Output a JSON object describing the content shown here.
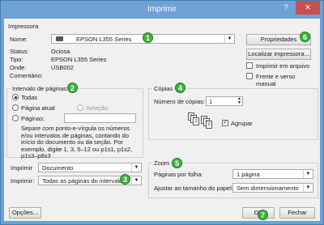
{
  "window": {
    "title": "Imprimir",
    "help": "?",
    "close": "✕"
  },
  "printer": {
    "group_title": "Impressora",
    "name_label": "Nome:",
    "name_value": "EPSON L355 Series",
    "status_label": "Status:",
    "status_value": "Ociosa",
    "type_label": "Tipo:",
    "type_value": "EPSON L355 Series",
    "where_label": "Onde:",
    "where_value": "USB002",
    "comment_label": "Comentário:",
    "properties_button": "Propriedades",
    "find_button": "Localizar impressora...",
    "print_to_file": "Imprimir em arquivo",
    "duplex_manual": "Frente e verso manual"
  },
  "range": {
    "group_title": "Intervalo de páginas",
    "all": "Todas",
    "current": "Página atual",
    "selection": "Seleção",
    "pages": "Páginas:",
    "pages_value": "",
    "hint": "Separe com ponto-e-vírgula os números e/ou intervalos de páginas, contando do início do documento ou da seção. Por exemplo, digite 1, 3, 5–12 ou p1s1, p1s2, p1s3–p8s3"
  },
  "copies": {
    "group_title": "Cópias",
    "count_label": "Número de cópias:",
    "count_value": "1",
    "collate": "Agrupar"
  },
  "print_what": {
    "label": "Imprimir",
    "value": "Documento"
  },
  "print_pages": {
    "label": "Imprimir:",
    "value": "Todas as páginas do intervalo"
  },
  "zoom": {
    "group_title": "Zoom",
    "pages_per_sheet_label": "Páginas por folha:",
    "pages_per_sheet_value": "1 página",
    "scale_label": "Ajustar ao tamanho do papel:",
    "scale_value": "Sem dimensionamento"
  },
  "footer": {
    "options": "Opções...",
    "ok": "OK",
    "cancel": "Fechar"
  },
  "badges": [
    "1",
    "2",
    "3",
    "4",
    "5",
    "6",
    "7"
  ],
  "colors": {
    "titlebar": "#6fa0d6",
    "close": "#c75050",
    "badge": "#3db33d"
  }
}
